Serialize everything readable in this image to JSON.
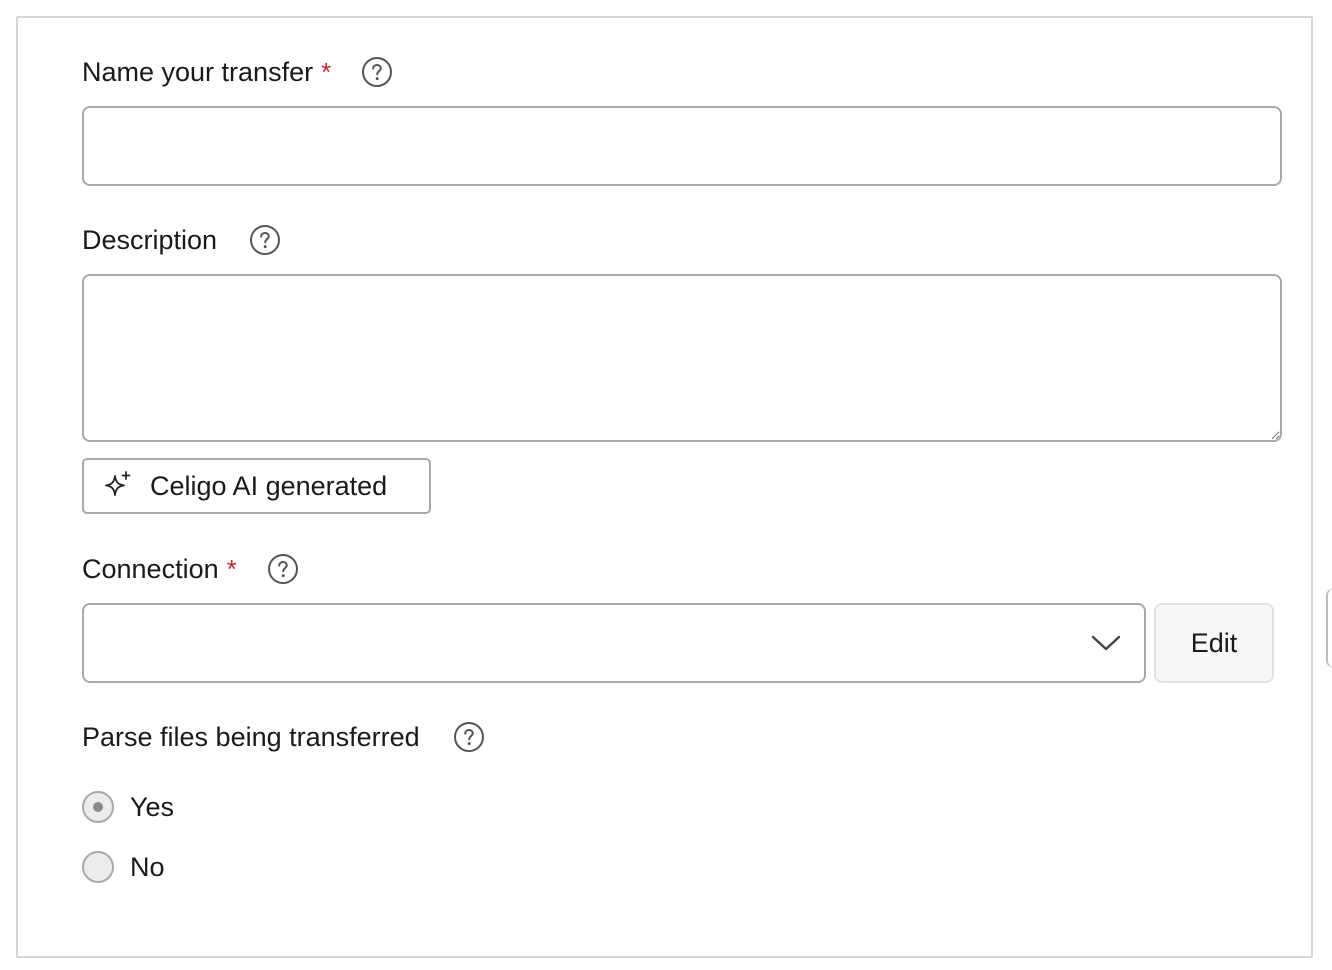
{
  "form": {
    "name_field": {
      "label": "Name your transfer",
      "required_mark": "*",
      "value": "",
      "placeholder": ""
    },
    "description_field": {
      "label": "Description",
      "value": "",
      "placeholder": ""
    },
    "ai_button": {
      "label": "Celigo AI generated",
      "icon": "sparkle-icon"
    },
    "connection_field": {
      "label": "Connection",
      "required_mark": "*",
      "selected_value": "",
      "edit_label": "Edit"
    },
    "parse_field": {
      "label": "Parse files being transferred",
      "options": [
        {
          "label": "Yes",
          "selected": true
        },
        {
          "label": "No",
          "selected": false
        }
      ]
    }
  },
  "colors": {
    "required": "#c62828",
    "border": "#a9a9a9",
    "panel_border": "#d6d6d6"
  }
}
